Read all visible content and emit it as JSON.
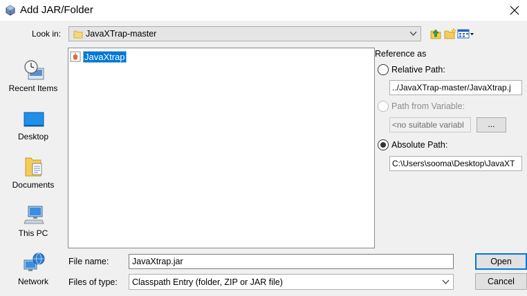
{
  "window": {
    "title": "Add JAR/Folder"
  },
  "lookin": {
    "label": "Look in:",
    "value": "JavaXTrap-master"
  },
  "places": [
    {
      "label": "Recent Items",
      "icon": "recent-items-icon"
    },
    {
      "label": "Desktop",
      "icon": "desktop-icon"
    },
    {
      "label": "Documents",
      "icon": "documents-icon"
    },
    {
      "label": "This PC",
      "icon": "this-pc-icon"
    },
    {
      "label": "Network",
      "icon": "network-icon"
    }
  ],
  "files": [
    {
      "name": "JavaXtrap",
      "icon": "jar-file-icon",
      "selected": true
    }
  ],
  "reference": {
    "heading": "Reference as",
    "relative_label": "Relative Path:",
    "relative_value": "../JavaXTrap-master/JavaXtrap.j",
    "variable_label": "Path from Variable:",
    "variable_value": "<no suitable variabl",
    "variable_button": "...",
    "absolute_label": "Absolute Path:",
    "absolute_value": "C:\\Users\\sooma\\Desktop\\JavaXT",
    "selected": "absolute"
  },
  "filename": {
    "label": "File name:",
    "value": "JavaXtrap.jar"
  },
  "filetype": {
    "label": "Files of type:",
    "value": "Classpath Entry (folder, ZIP or JAR file)"
  },
  "buttons": {
    "open": "Open",
    "cancel": "Cancel"
  },
  "colors": {
    "selection": "#0078d7",
    "background": "#f0f0f0"
  }
}
